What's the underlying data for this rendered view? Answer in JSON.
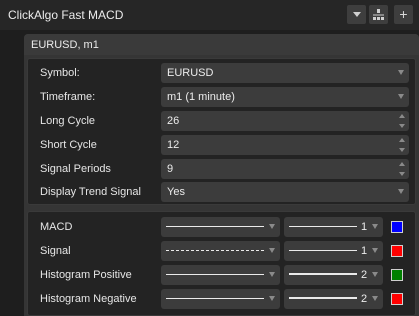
{
  "window": {
    "title": "ClickAlgo Fast MACD",
    "add_glyph": "+",
    "icons": [
      "chevron-down-icon",
      "separator-icon",
      "plus-icon"
    ]
  },
  "instance": {
    "header": "EURUSD, m1"
  },
  "parameters": [
    {
      "label": "Symbol:",
      "value": "EURUSD",
      "control": "dropdown"
    },
    {
      "label": "Timeframe:",
      "value": "m1 (1 minute)",
      "control": "dropdown"
    },
    {
      "label": "Long Cycle",
      "value": "26",
      "control": "spinner"
    },
    {
      "label": "Short Cycle",
      "value": "12",
      "control": "spinner"
    },
    {
      "label": "Signal Periods",
      "value": "9",
      "control": "spinner"
    },
    {
      "label": "Display Trend Signal",
      "value": "Yes",
      "control": "dropdown"
    }
  ],
  "outputs": [
    {
      "label": "MACD",
      "line_style": "solid",
      "thickness": "1",
      "color": "#0000ff"
    },
    {
      "label": "Signal",
      "line_style": "dashed",
      "thickness": "1",
      "color": "#ff0000"
    },
    {
      "label": "Histogram Positive",
      "line_style": "solid",
      "thickness": "2",
      "color": "#008000"
    },
    {
      "label": "Histogram Negative",
      "line_style": "solid",
      "thickness": "2",
      "color": "#ff0000"
    }
  ]
}
